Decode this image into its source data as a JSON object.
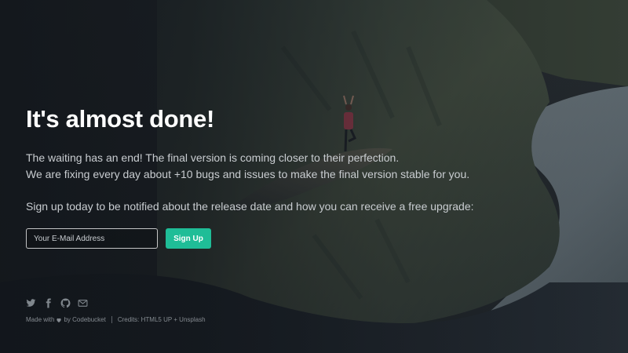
{
  "hero": {
    "title": "It's almost done!",
    "line1": "The waiting has an end! The final version is coming closer to their perfection.",
    "line2": "We are fixing every day about +10 bugs and issues to make the final version stable for you.",
    "line3": "Sign up today to be notified about the release date and how you can receive a free upgrade:"
  },
  "signup": {
    "email_placeholder": "Your E-Mail Address",
    "button_label": "Sign Up"
  },
  "social": {
    "icons": [
      "twitter-icon",
      "facebook-icon",
      "github-icon",
      "mail-icon"
    ]
  },
  "footer": {
    "made_with": "Made with",
    "by_text": "by Codebucket",
    "credits": "Credits: HTML5 UP + Unsplash"
  },
  "colors": {
    "accent": "#1fbd97",
    "background": "#1c2228",
    "text_primary": "#ffffff",
    "text_secondary": "#c9cdd1",
    "footer_text": "#858b91"
  }
}
